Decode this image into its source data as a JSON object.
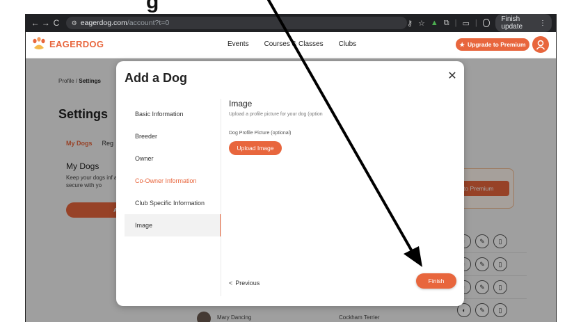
{
  "caption_fragment": "g",
  "browser": {
    "url_host": "eagerdog.com",
    "url_path": "/account?t=0",
    "finish_update_label": "Finish update",
    "nav_back": "←",
    "nav_forward": "→",
    "nav_reload": "C"
  },
  "site": {
    "logo_text": "EAGERDOG",
    "nav": [
      "Events",
      "Courses & Classes",
      "Clubs"
    ],
    "premium_label": "Upgrade to Premium"
  },
  "backdrop": {
    "breadcrumb_profile": "Profile",
    "breadcrumb_sep": " / ",
    "breadcrumb_current": "Settings",
    "settings_title": "Settings",
    "tab_active": "My Dogs",
    "tab_other": "Reg",
    "mydogs_title": "My Dogs",
    "mydogs_desc": "Keep your dogs inf and secure with yo",
    "add_bar_label": "A",
    "upgrade_btn": "to Premium",
    "partial_name": "Mary Dancing",
    "partial_breed": "Cockham Terrier"
  },
  "modal": {
    "title": "Add a Dog",
    "close_glyph": "✕",
    "steps": [
      {
        "label": "Basic Information"
      },
      {
        "label": "Breeder"
      },
      {
        "label": "Owner"
      },
      {
        "label": "Co-Owner Information"
      },
      {
        "label": "Club Specific Information"
      },
      {
        "label": "Image"
      }
    ],
    "panel_title": "Image",
    "panel_sub": "Upload a profile picture for your dog (option",
    "field_label": "Dog Profile Picture (optional)",
    "upload_label": "Upload Image",
    "previous_label": "Previous",
    "previous_glyph": "<",
    "finish_label": "Finish"
  },
  "colors": {
    "accent": "#e8663d",
    "chrome": "#202124"
  }
}
